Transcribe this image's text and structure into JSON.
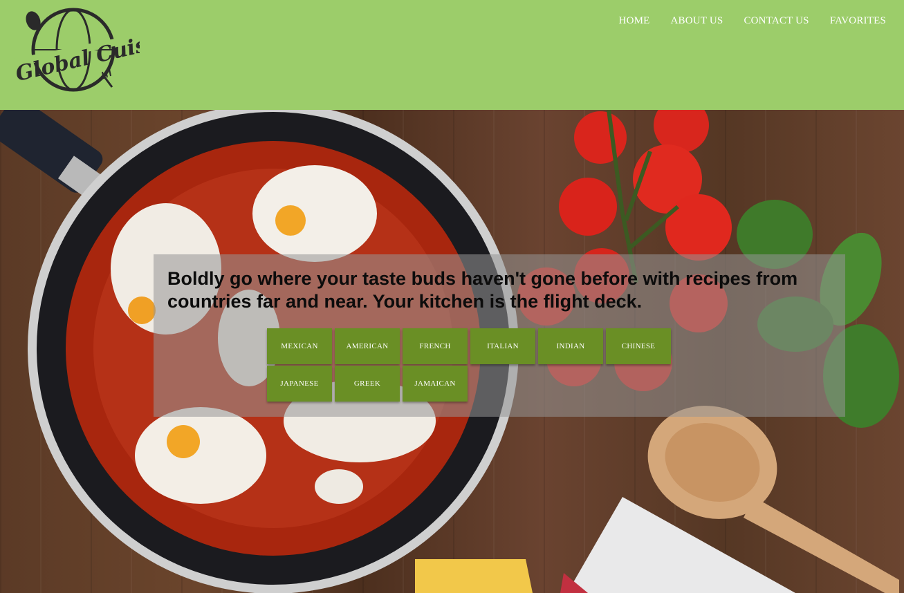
{
  "brand": {
    "logo_text": "Global Cuisine"
  },
  "nav": {
    "items": [
      {
        "label": "HOME"
      },
      {
        "label": "ABOUT US"
      },
      {
        "label": "CONTACT US"
      },
      {
        "label": "FAVORITES"
      }
    ]
  },
  "hero": {
    "tagline": "Boldly go where your taste buds haven't gone before with recipes from countries far and near. Your kitchen is the flight deck.",
    "cuisines": [
      {
        "label": "MEXICAN"
      },
      {
        "label": "AMERICAN"
      },
      {
        "label": "FRENCH"
      },
      {
        "label": "ITALIAN"
      },
      {
        "label": "INDIAN"
      },
      {
        "label": "CHINESE"
      },
      {
        "label": "JAPANESE"
      },
      {
        "label": "GREEK"
      },
      {
        "label": "JAMAICAN"
      }
    ]
  },
  "colors": {
    "header_bg": "#9ccd6a",
    "button_bg": "#6a8f25",
    "nav_text": "#ffffff"
  }
}
